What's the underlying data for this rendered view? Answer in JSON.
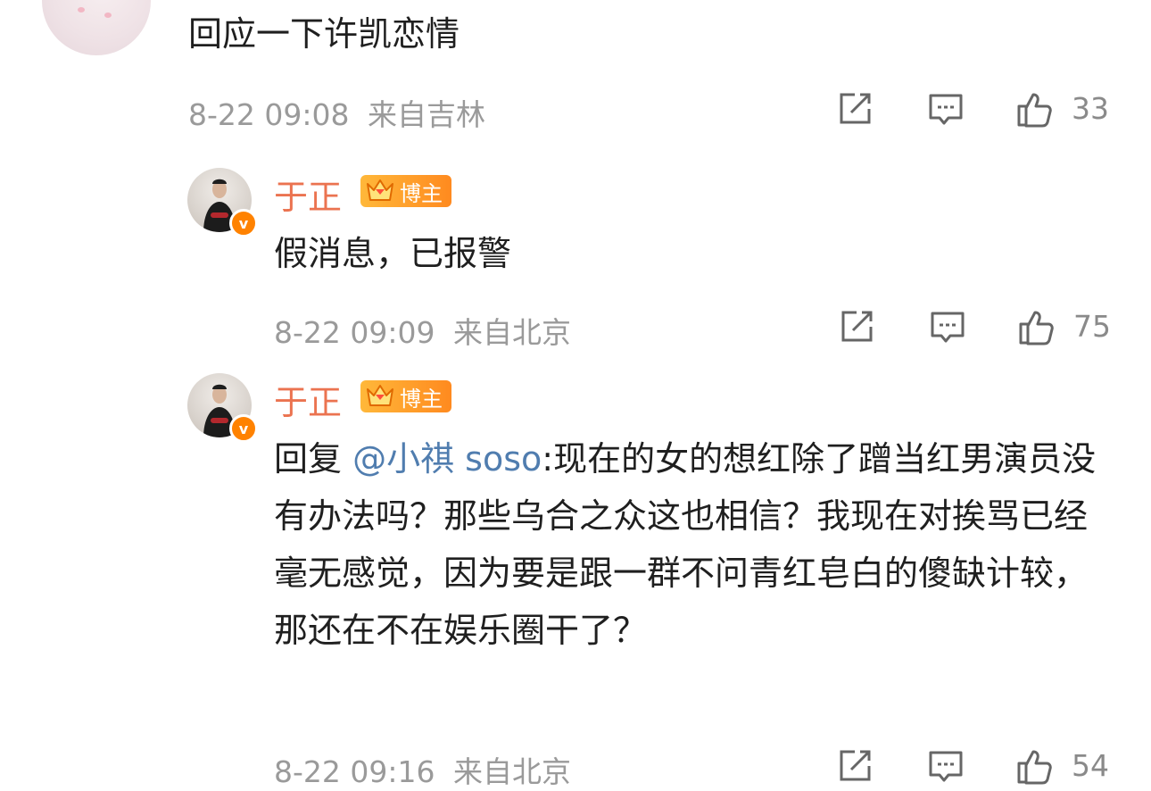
{
  "comments": [
    {
      "text": "回应一下许凯恋情",
      "time": "8-22 09:08",
      "location": "来自吉林",
      "likes": "33"
    },
    {
      "username": "于正",
      "tag": "博主",
      "text": "假消息，已报警",
      "time": "8-22 09:09",
      "location": "来自北京",
      "likes": "75"
    },
    {
      "username": "于正",
      "tag": "博主",
      "reply_prefix": "回复 ",
      "mention": "@小祺 soso",
      "text": ":现在的女的想红除了蹭当红男演员没有办法吗？那些乌合之众这也相信？我现在对挨骂已经毫无感觉，因为要是跟一群不问青红皂白的傻缺计较，那还在不在娱乐圈干了？",
      "time": "8-22 09:16",
      "location": "来自北京",
      "likes": "54"
    }
  ],
  "icons": {
    "repost": "repost-icon",
    "comment": "comment-icon",
    "like": "like-icon",
    "verified": "verified-icon",
    "crown": "crown-icon"
  },
  "colors": {
    "username": "#eb7350",
    "mention": "#507daf",
    "meta": "#9a9a9a",
    "verified": "#ff8200",
    "tag_start": "#ffb83a",
    "tag_end": "#ff8a1f"
  }
}
